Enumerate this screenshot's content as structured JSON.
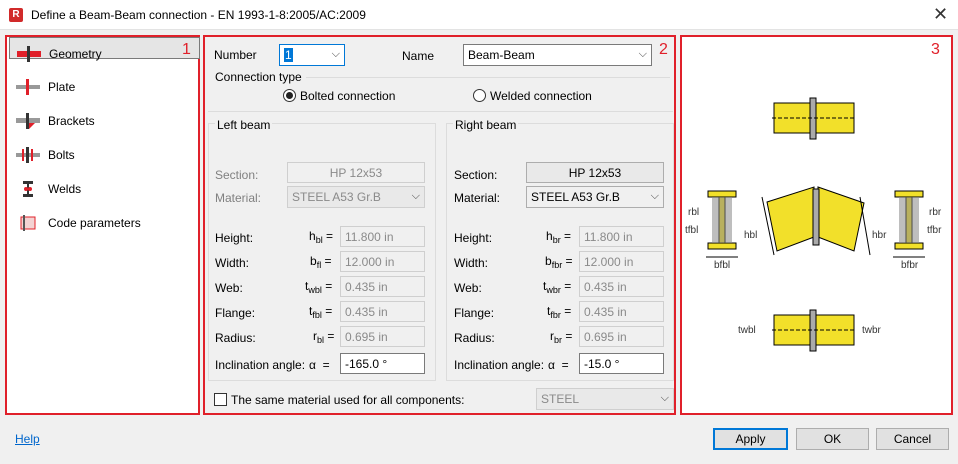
{
  "window": {
    "title": "Define a Beam-Beam connection - EN 1993-1-8:2005/AC:2009",
    "app_icon_letter": "R"
  },
  "panel_numbers": [
    "1",
    "2",
    "3"
  ],
  "nav": {
    "items": [
      {
        "label": "Geometry",
        "icon": "geometry-icon",
        "selected": true
      },
      {
        "label": "Plate",
        "icon": "plate-icon"
      },
      {
        "label": "Brackets",
        "icon": "brackets-icon"
      },
      {
        "label": "Bolts",
        "icon": "bolts-icon"
      },
      {
        "label": "Welds",
        "icon": "welds-icon"
      },
      {
        "label": "Code parameters",
        "icon": "code-parameters-icon"
      }
    ]
  },
  "form": {
    "number_label": "Number",
    "number_value": "1",
    "name_label": "Name",
    "name_value": "Beam-Beam",
    "connection_type_label": "Connection type",
    "bolted_label": "Bolted connection",
    "welded_label": "Welded connection",
    "selected_type": "bolted",
    "eq": "=",
    "alpha": "α",
    "left": {
      "title": "Left beam",
      "section_label": "Section:",
      "section_value": "HP 12x53",
      "material_label": "Material:",
      "material_value": "STEEL A53 Gr.B",
      "height_label": "Height:",
      "height_sym": "h",
      "height_sub": "bl",
      "height_value": "11.800 in",
      "width_label": "Width:",
      "width_sym": "b",
      "width_sub": "fl",
      "width_value": "12.000 in",
      "web_label": "Web:",
      "web_sym": "t",
      "web_sub": "wbl",
      "web_value": "0.435 in",
      "flange_label": "Flange:",
      "flange_sym": "t",
      "flange_sub": "fbl",
      "flange_value": "0.435 in",
      "radius_label": "Radius:",
      "radius_sym": "r",
      "radius_sub": "bl",
      "radius_value": "0.695 in",
      "incl_label": "Inclination angle:",
      "incl_value": "-165.0 °"
    },
    "right": {
      "title": "Right beam",
      "section_label": "Section:",
      "section_value": "HP 12x53",
      "material_label": "Material:",
      "material_value": "STEEL A53 Gr.B",
      "height_label": "Height:",
      "height_sym": "h",
      "height_sub": "br",
      "height_value": "11.800 in",
      "width_label": "Width:",
      "width_sym": "b",
      "width_sub": "fbr",
      "width_value": "12.000 in",
      "web_label": "Web:",
      "web_sym": "t",
      "web_sub": "wbr",
      "web_value": "0.435 in",
      "flange_label": "Flange:",
      "flange_sym": "t",
      "flange_sub": "fbr",
      "flange_value": "0.435 in",
      "radius_label": "Radius:",
      "radius_sym": "r",
      "radius_sub": "br",
      "radius_value": "0.695 in",
      "incl_label": "Inclination angle:",
      "incl_value": "-15.0 °"
    },
    "same_material_label": "The same material used for all components:",
    "same_material_value": "STEEL",
    "same_material_checked": false
  },
  "diagram_labels": {
    "hbl": "hbl",
    "hbr": "hbr",
    "rbl": "rbl",
    "rbr": "rbr",
    "tfbl": "tfbl",
    "tfbr": "tfbr",
    "bfbl": "bfbl",
    "bfbr": "bfbr",
    "twbl": "twbl",
    "twbr": "twbr"
  },
  "footer": {
    "help_label": "Help",
    "apply_label": "Apply",
    "ok_label": "OK",
    "cancel_label": "Cancel"
  },
  "colors": {
    "accent_red": "#e0202a",
    "beam_yellow": "#f2e02a",
    "default_button_border": "#0078d7"
  }
}
